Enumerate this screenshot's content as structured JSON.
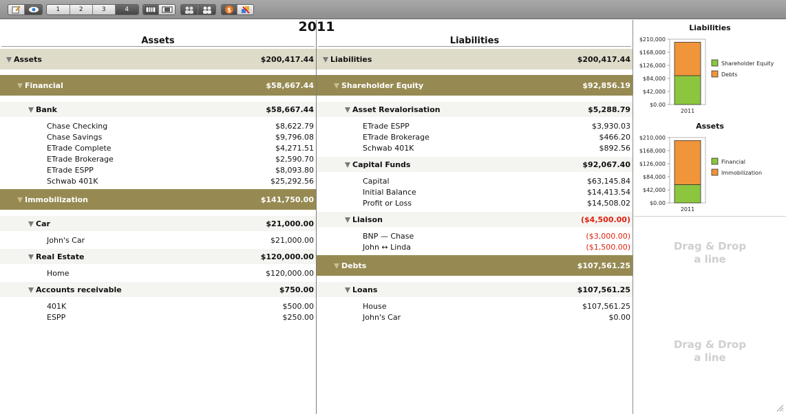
{
  "toolbar": {
    "pages": [
      "1",
      "2",
      "3",
      "4"
    ],
    "active_page": "4"
  },
  "year": "2011",
  "assets": {
    "title": "Assets",
    "total_label": "Assets",
    "total_value": "$200,417.44",
    "categories": [
      {
        "label": "Financial",
        "value": "$58,667.44",
        "groups": [
          {
            "label": "Bank",
            "value": "$58,667.44",
            "items": [
              {
                "label": "Chase Checking",
                "value": "$8,622.79"
              },
              {
                "label": "Chase Savings",
                "value": "$9,796.08"
              },
              {
                "label": "ETrade Complete",
                "value": "$4,271.51"
              },
              {
                "label": "ETrade Brokerage",
                "value": "$2,590.70"
              },
              {
                "label": "ETrade ESPP",
                "value": "$8,093.80"
              },
              {
                "label": "Schwab 401K",
                "value": "$25,292.56"
              }
            ]
          }
        ]
      },
      {
        "label": "Immobilization",
        "value": "$141,750.00",
        "groups": [
          {
            "label": "Car",
            "value": "$21,000.00",
            "items": [
              {
                "label": "John's Car",
                "value": "$21,000.00"
              }
            ]
          },
          {
            "label": "Real Estate",
            "value": "$120,000.00",
            "items": [
              {
                "label": "Home",
                "value": "$120,000.00"
              }
            ]
          },
          {
            "label": "Accounts receivable",
            "value": "$750.00",
            "items": [
              {
                "label": "401K",
                "value": "$500.00"
              },
              {
                "label": "ESPP",
                "value": "$250.00"
              }
            ]
          }
        ]
      }
    ]
  },
  "liabilities": {
    "title": "Liabilities",
    "total_label": "Liabilities",
    "total_value": "$200,417.44",
    "categories": [
      {
        "label": "Shareholder Equity",
        "value": "$92,856.19",
        "groups": [
          {
            "label": "Asset Revalorisation",
            "value": "$5,288.79",
            "items": [
              {
                "label": "ETrade ESPP",
                "value": "$3,930.03"
              },
              {
                "label": "ETrade Brokerage",
                "value": "$466.20"
              },
              {
                "label": "Schwab 401K",
                "value": "$892.56"
              }
            ]
          },
          {
            "label": "Capital Funds",
            "value": "$92,067.40",
            "items": [
              {
                "label": "Capital",
                "value": "$63,145.84"
              },
              {
                "label": "Initial Balance",
                "value": "$14,413.54"
              },
              {
                "label": "Profit or Loss",
                "value": "$14,508.02"
              }
            ]
          },
          {
            "label": "Liaison",
            "value": "($4,500.00)",
            "negative": true,
            "items": [
              {
                "label": "BNP — Chase",
                "value": "($3,000.00)",
                "negative": true
              },
              {
                "label": "John ↔ Linda",
                "value": "($1,500.00)",
                "negative": true
              }
            ]
          }
        ]
      },
      {
        "label": "Debts",
        "value": "$107,561.25",
        "groups": [
          {
            "label": "Loans",
            "value": "$107,561.25",
            "items": [
              {
                "label": "House",
                "value": "$107,561.25"
              },
              {
                "label": "John's Car",
                "value": "$0.00"
              }
            ]
          }
        ]
      }
    ]
  },
  "colors": {
    "green": "#8cc63f",
    "orange": "#f0953a",
    "header": "#968a52",
    "top_row": "#dedbc9",
    "negative": "#e0210f"
  },
  "chart_data": [
    {
      "type": "bar",
      "title": "Liabilities",
      "categories": [
        "2011"
      ],
      "stacked": true,
      "series": [
        {
          "name": "Shareholder Equity",
          "values": [
            92856.19
          ],
          "color": "#8cc63f"
        },
        {
          "name": "Debts",
          "values": [
            107561.25
          ],
          "color": "#f0953a"
        }
      ],
      "yticks": [
        "$210,000",
        "$168,000",
        "$126,000",
        "$84,000",
        "$42,000",
        "$0.00"
      ],
      "ylim": [
        0,
        210000
      ],
      "legend": "right"
    },
    {
      "type": "bar",
      "title": "Assets",
      "categories": [
        "2011"
      ],
      "stacked": true,
      "series": [
        {
          "name": "Financial",
          "values": [
            58667.44
          ],
          "color": "#8cc63f"
        },
        {
          "name": "Immobilization",
          "values": [
            141750.0
          ],
          "color": "#f0953a"
        }
      ],
      "yticks": [
        "$210,000",
        "$168,000",
        "$126,000",
        "$84,000",
        "$42,000",
        "$0.00"
      ],
      "ylim": [
        0,
        210000
      ],
      "legend": "right"
    }
  ],
  "dnd_text": [
    "Drag & Drop",
    "a line"
  ]
}
